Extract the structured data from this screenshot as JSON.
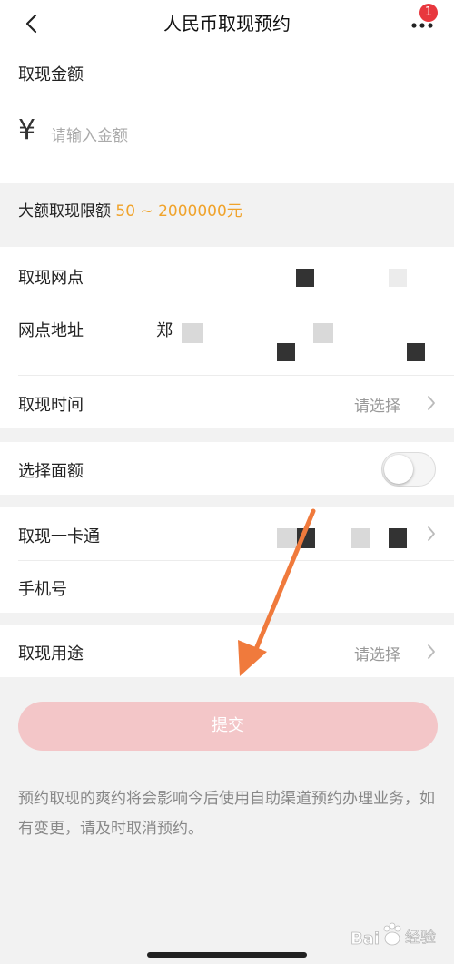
{
  "nav": {
    "title": "人民币取现预约",
    "badge": "1"
  },
  "amount": {
    "label": "取现金额",
    "currency": "¥",
    "placeholder": "请输入金额"
  },
  "limit": {
    "label": "大额取现限额",
    "value": "50 ~ 2000000元"
  },
  "branch": {
    "outlet_label": "取现网点",
    "address_label": "网点地址",
    "address_value": "郑"
  },
  "time": {
    "label": "取现时间",
    "value": "请选择"
  },
  "denomination": {
    "label": "选择面额",
    "enabled": false
  },
  "card": {
    "label": "取现一卡通"
  },
  "phone": {
    "label": "手机号"
  },
  "purpose": {
    "label": "取现用途",
    "value": "请选择"
  },
  "submit": {
    "label": "提交"
  },
  "notice": {
    "text": "预约取现的爽约将会影响今后使用自助渠道预约办理业务，如有变更，请及时取消预约。"
  },
  "watermark": {
    "text": "经验"
  },
  "colors": {
    "accent": "#f0a32b",
    "submit_bg": "#f3c6c8",
    "badge": "#e8373e",
    "annotation_arrow": "#f07a3c"
  }
}
